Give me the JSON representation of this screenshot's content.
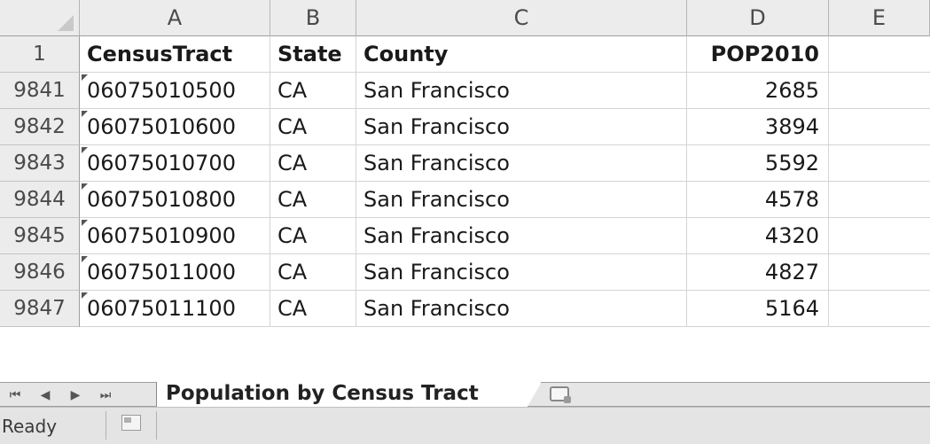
{
  "columns": [
    "A",
    "B",
    "C",
    "D",
    "E"
  ],
  "header_row": {
    "row_number": "1",
    "cells": [
      "CensusTract",
      "State",
      "County",
      "POP2010",
      ""
    ]
  },
  "rows": [
    {
      "row_number": "9841",
      "tract": "06075010500",
      "state": "CA",
      "county": "San Francisco",
      "pop": "2685"
    },
    {
      "row_number": "9842",
      "tract": "06075010600",
      "state": "CA",
      "county": "San Francisco",
      "pop": "3894"
    },
    {
      "row_number": "9843",
      "tract": "06075010700",
      "state": "CA",
      "county": "San Francisco",
      "pop": "5592"
    },
    {
      "row_number": "9844",
      "tract": "06075010800",
      "state": "CA",
      "county": "San Francisco",
      "pop": "4578"
    },
    {
      "row_number": "9845",
      "tract": "06075010900",
      "state": "CA",
      "county": "San Francisco",
      "pop": "4320"
    },
    {
      "row_number": "9846",
      "tract": "06075011000",
      "state": "CA",
      "county": "San Francisco",
      "pop": "4827"
    },
    {
      "row_number": "9847",
      "tract": "06075011100",
      "state": "CA",
      "county": "San Francisco",
      "pop": "5164"
    }
  ],
  "sheet_tabs": {
    "active": "Population by Census Tract",
    "nav_icons": [
      "first-sheet-icon",
      "prev-sheet-icon",
      "next-sheet-icon",
      "last-sheet-icon"
    ],
    "new_sheet_icon": "insert-worksheet-icon"
  },
  "status_bar": {
    "status": "Ready",
    "macro_icon": "record-macro-icon"
  },
  "colors": {
    "header_bg": "#ececec",
    "gridline": "#d4d4d4",
    "text": "#1a1a1a"
  }
}
